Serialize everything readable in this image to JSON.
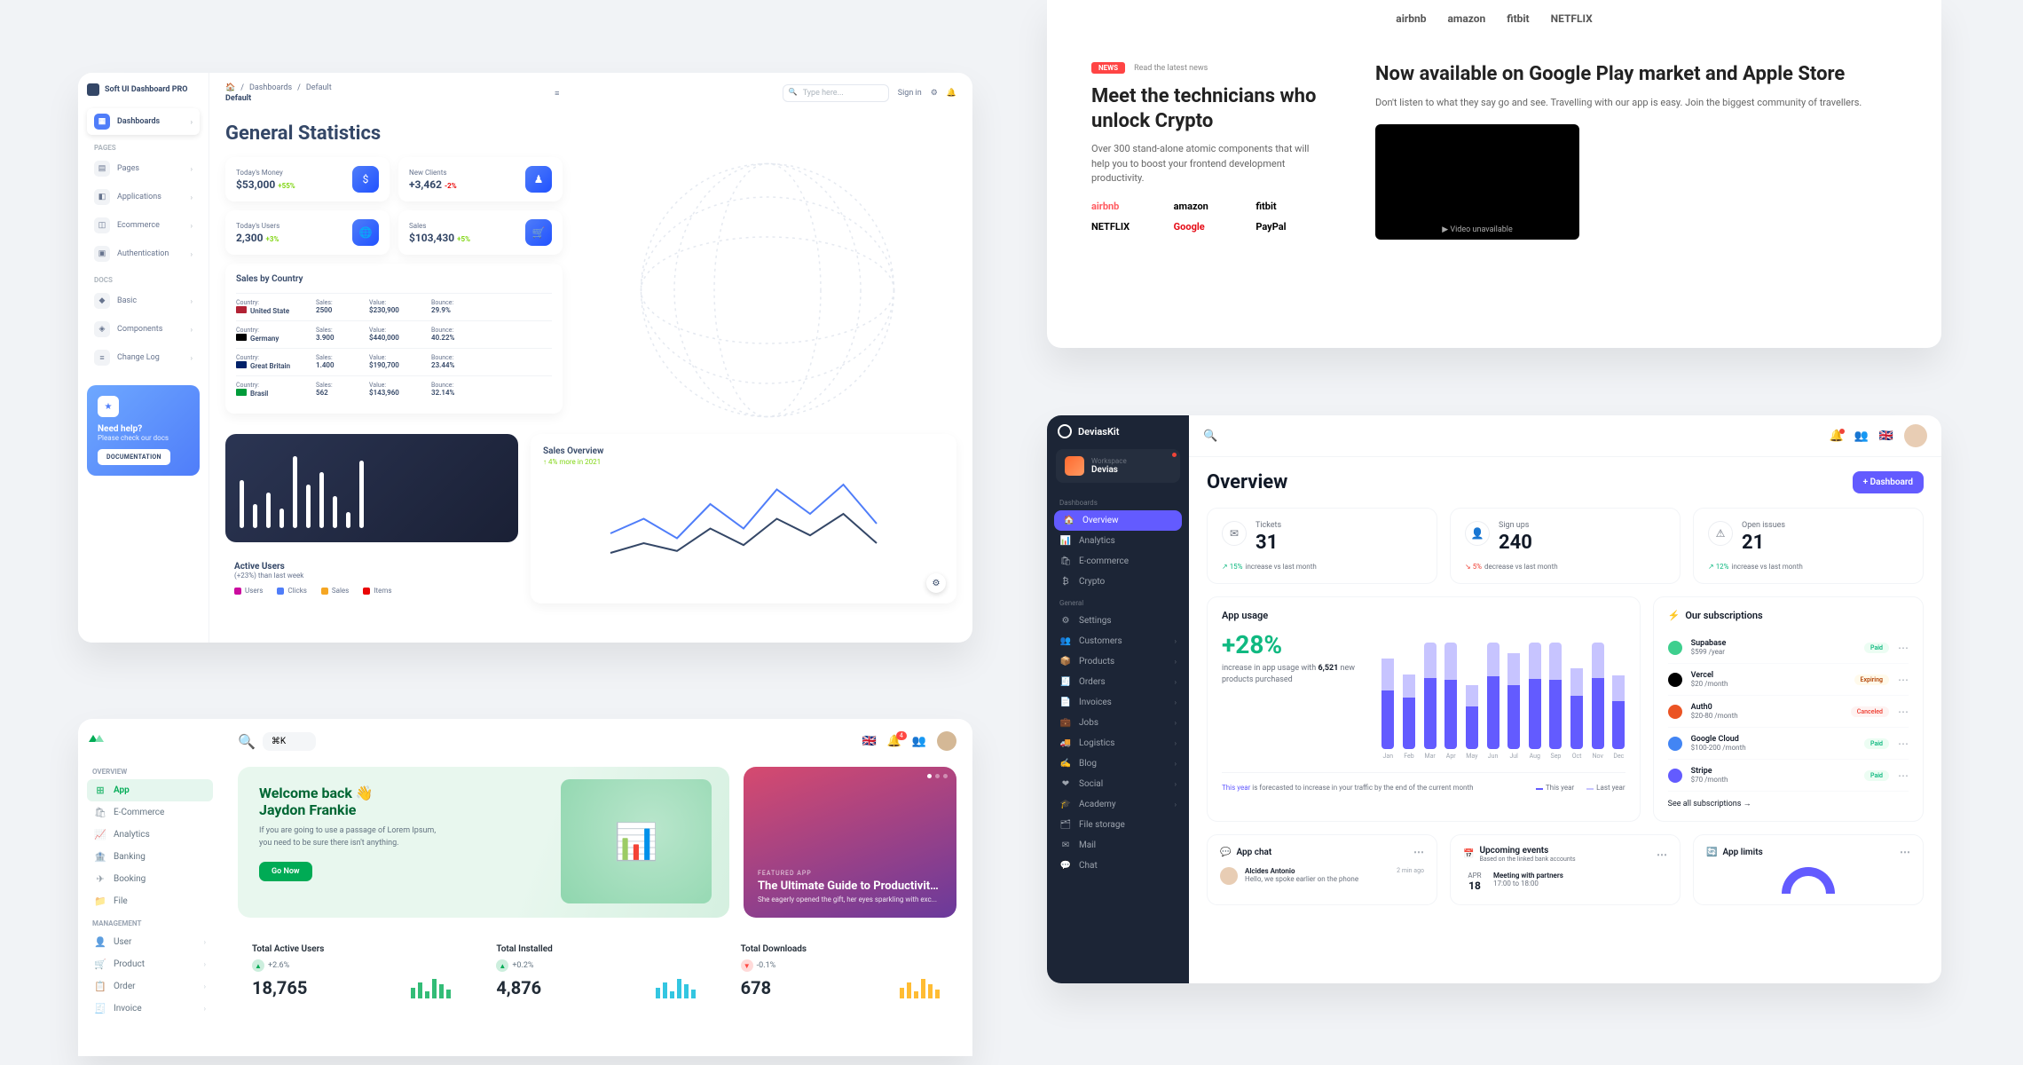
{
  "panel_a": {
    "brand": "Soft UI Dashboard PRO",
    "breadcrumb": {
      "home": "🏠",
      "path": "Dashboards",
      "current": "Default"
    },
    "page_label": "Default",
    "search_placeholder": "Type here...",
    "signin": "Sign in",
    "sidebar": {
      "sections": [
        {
          "items": [
            {
              "label": "Dashboards",
              "icon": "▦",
              "active": true
            }
          ]
        },
        {
          "label": "PAGES",
          "items": [
            {
              "label": "Pages",
              "icon": "▤"
            },
            {
              "label": "Applications",
              "icon": "◧"
            },
            {
              "label": "Ecommerce",
              "icon": "◫"
            },
            {
              "label": "Authentication",
              "icon": "▣"
            }
          ]
        },
        {
          "label": "DOCS",
          "items": [
            {
              "label": "Basic",
              "icon": "◆"
            },
            {
              "label": "Components",
              "icon": "◈"
            },
            {
              "label": "Change Log",
              "icon": "≡"
            }
          ]
        }
      ],
      "help": {
        "title": "Need help?",
        "subtitle": "Please check our docs",
        "button": "DOCUMENTATION",
        "icon": "★"
      }
    },
    "title": "General Statistics",
    "stats": [
      {
        "label": "Today's Money",
        "value": "$53,000",
        "delta": "+55%",
        "dir": "up",
        "icon": "$"
      },
      {
        "label": "New Clients",
        "value": "+3,462",
        "delta": "-2%",
        "dir": "dn",
        "icon": "♟"
      },
      {
        "label": "Today's Users",
        "value": "2,300",
        "delta": "+3%",
        "dir": "up",
        "icon": "🌐"
      },
      {
        "label": "Sales",
        "value": "$103,430",
        "delta": "+5%",
        "dir": "up",
        "icon": "🛒"
      }
    ],
    "sbc": {
      "title": "Sales by Country",
      "cols": [
        "Country:",
        "Sales:",
        "Value:",
        "Bounce:"
      ],
      "rows": [
        {
          "flag": "#b22234",
          "country": "United State",
          "sales": "2500",
          "value": "$230,900",
          "bounce": "29.9%"
        },
        {
          "flag": "#000",
          "country": "Germany",
          "sales": "3.900",
          "value": "$440,000",
          "bounce": "40.22%"
        },
        {
          "flag": "#012169",
          "country": "Great Britain",
          "sales": "1.400",
          "value": "$190,700",
          "bounce": "23.44%"
        },
        {
          "flag": "#009b3a",
          "country": "Brasil",
          "sales": "562",
          "value": "$143,960",
          "bounce": "32.14%"
        }
      ]
    },
    "active_users": {
      "title": "Active Users",
      "subtitle": "(+23%) than last week",
      "legend": [
        {
          "label": "Users",
          "color": "#cb0c9f"
        },
        {
          "label": "Clicks",
          "color": "#4f7df9"
        },
        {
          "label": "Sales",
          "color": "#f5a623"
        },
        {
          "label": "Items",
          "color": "#ea0606"
        }
      ]
    },
    "sales_overview": {
      "title": "Sales Overview",
      "subtitle": "↑ 4% more in 2021"
    }
  },
  "chart_data": [
    {
      "id": "pa_bars",
      "type": "bar",
      "values": [
        60,
        30,
        45,
        25,
        90,
        55,
        70,
        40,
        20,
        85
      ],
      "ylim": [
        0,
        100
      ]
    },
    {
      "id": "pa_line",
      "type": "line",
      "series": [
        {
          "name": "A",
          "color": "#4f7df9",
          "values": [
            40,
            55,
            35,
            70,
            45,
            85,
            60,
            90,
            50
          ]
        },
        {
          "name": "B",
          "color": "#344767",
          "values": [
            20,
            30,
            22,
            45,
            28,
            55,
            38,
            60,
            30
          ]
        }
      ],
      "x": [
        1,
        2,
        3,
        4,
        5,
        6,
        7,
        8,
        9
      ],
      "ylim": [
        0,
        100
      ]
    },
    {
      "id": "pd_bars",
      "type": "bar",
      "categories": [
        "Jan",
        "Feb",
        "Mar",
        "Apr",
        "May",
        "Jun",
        "Jul",
        "Aug",
        "Sep",
        "Oct",
        "Nov",
        "Dec"
      ],
      "series": [
        {
          "name": "This year",
          "color": "#635bff",
          "values": [
            55,
            48,
            90,
            65,
            40,
            85,
            60,
            92,
            70,
            50,
            85,
            45
          ]
        },
        {
          "name": "Last year",
          "color": "#c7c4ff",
          "values": [
            30,
            22,
            45,
            35,
            20,
            40,
            30,
            48,
            38,
            26,
            42,
            24
          ]
        }
      ],
      "ylim": [
        0,
        100
      ]
    }
  ],
  "panel_b": {
    "top_brands": [
      "airbnb",
      "amazon",
      "fitbit",
      "NETFLIX"
    ],
    "news_badge": "NEWS",
    "news_link": "Read the latest news",
    "col1": {
      "title": "Meet the technicians who unlock Crypto",
      "sub": "Over 300 stand-alone atomic components that will help you to boost your frontend development productivity.",
      "brands": [
        "airbnb",
        "amazon",
        "fitbit",
        "NETFLIX",
        "Google",
        "PayPal"
      ]
    },
    "col2": {
      "title": "Now available on Google Play market and Apple Store",
      "sub": "Don't listen to what they say go and see. Travelling with our app is easy. Join the biggest community of travellers.",
      "video": "Video unavailable"
    }
  },
  "panel_c": {
    "search": "⌘K",
    "sections": [
      {
        "label": "OVERVIEW",
        "items": [
          {
            "label": "App",
            "icon": "⊞",
            "active": true
          },
          {
            "label": "E-Commerce",
            "icon": "🛍"
          },
          {
            "label": "Analytics",
            "icon": "📈"
          },
          {
            "label": "Banking",
            "icon": "🏦"
          },
          {
            "label": "Booking",
            "icon": "✈"
          },
          {
            "label": "File",
            "icon": "📁"
          }
        ]
      },
      {
        "label": "MANAGEMENT",
        "items": [
          {
            "label": "User",
            "icon": "👤",
            "chev": true
          },
          {
            "label": "Product",
            "icon": "🛒",
            "chev": true
          },
          {
            "label": "Order",
            "icon": "📋",
            "chev": true
          },
          {
            "label": "Invoice",
            "icon": "🧾",
            "chev": true
          }
        ]
      }
    ],
    "hero": {
      "greeting": "Welcome back 👋",
      "name": "Jaydon Frankie",
      "sub": "If you are going to use a passage of Lorem Ipsum, you need to be sure there isn't anything.",
      "cta": "Go Now"
    },
    "featured": {
      "label": "FEATURED APP",
      "title": "The Ultimate Guide to Productivity H...",
      "sub": "She eagerly opened the gift, her eyes sparkling with exc..."
    },
    "stats": [
      {
        "label": "Total Active Users",
        "delta": "+2.6%",
        "dir": "up",
        "value": "18,765",
        "spark": "#00ab55"
      },
      {
        "label": "Total Installed",
        "delta": "+0.2%",
        "dir": "up",
        "value": "4,876",
        "spark": "#00b8d9"
      },
      {
        "label": "Total Downloads",
        "delta": "-0.1%",
        "dir": "dn",
        "value": "678",
        "spark": "#ffab00"
      }
    ]
  },
  "panel_d": {
    "brand": "DeviasKit",
    "workspace": {
      "label": "Workspace",
      "name": "Devias"
    },
    "nav": [
      {
        "label": "Dashboards",
        "items": [
          {
            "label": "Overview",
            "icon": "🏠",
            "active": true
          },
          {
            "label": "Analytics",
            "icon": "📊"
          },
          {
            "label": "E-commerce",
            "icon": "🛍"
          },
          {
            "label": "Crypto",
            "icon": "₿"
          }
        ]
      },
      {
        "label": "General",
        "items": [
          {
            "label": "Settings",
            "icon": "⚙"
          },
          {
            "label": "Customers",
            "icon": "👥",
            "chev": true
          },
          {
            "label": "Products",
            "icon": "📦",
            "chev": true
          },
          {
            "label": "Orders",
            "icon": "🧾",
            "chev": true
          },
          {
            "label": "Invoices",
            "icon": "📄",
            "chev": true
          },
          {
            "label": "Jobs",
            "icon": "💼",
            "chev": true
          },
          {
            "label": "Logistics",
            "icon": "🚚",
            "chev": true
          },
          {
            "label": "Blog",
            "icon": "✍",
            "chev": true
          },
          {
            "label": "Social",
            "icon": "❤",
            "chev": true
          },
          {
            "label": "Academy",
            "icon": "🎓",
            "chev": true
          },
          {
            "label": "File storage",
            "icon": "🗂"
          },
          {
            "label": "Mail",
            "icon": "✉"
          },
          {
            "label": "Chat",
            "icon": "💬"
          }
        ]
      }
    ],
    "title": "Overview",
    "new_btn": "+ Dashboard",
    "kpis": [
      {
        "label": "Tickets",
        "value": "31",
        "delta": "15%",
        "dir": "up",
        "note": "increase vs last month",
        "icon": "✉"
      },
      {
        "label": "Sign ups",
        "value": "240",
        "delta": "5%",
        "dir": "dn",
        "note": "decrease vs last month",
        "icon": "👤"
      },
      {
        "label": "Open issues",
        "value": "21",
        "delta": "12%",
        "dir": "up",
        "note": "increase vs last month",
        "icon": "⚠"
      }
    ],
    "app_usage": {
      "title": "App usage",
      "big": "+28%",
      "sub_a": "increase in app usage with",
      "sub_b": "6,521",
      "sub_c": " new products purchased",
      "note_a": "This year",
      "note_b": " is forecasted to increase in your traffic by the end of the current month",
      "legend": [
        {
          "label": "This year",
          "color": "#635bff"
        },
        {
          "label": "Last year",
          "color": "#c7c4ff"
        }
      ]
    },
    "subs": {
      "title": "Our subscriptions",
      "items": [
        {
          "name": "Supabase",
          "price": "$599 /year",
          "status": "Paid",
          "color": "#3ecf8e"
        },
        {
          "name": "Vercel",
          "price": "$20 /month",
          "status": "Expiring",
          "color": "#000"
        },
        {
          "name": "Auth0",
          "price": "$20-80 /month",
          "status": "Canceled",
          "color": "#eb5424"
        },
        {
          "name": "Google Cloud",
          "price": "$100-200 /month",
          "status": "Paid",
          "color": "#4285f4"
        },
        {
          "name": "Stripe",
          "price": "$70 /month",
          "status": "Paid",
          "color": "#635bff"
        }
      ],
      "see_all": "See all subscriptions →"
    },
    "chat": {
      "title": "App chat",
      "name": "Alcides Antonio",
      "msg": "Hello, we spoke earlier on the phone",
      "time": "2 min ago"
    },
    "events": {
      "title": "Upcoming events",
      "sub": "Based on the linked bank accounts",
      "item": {
        "month": "APR",
        "day": "18",
        "title": "Meeting with partners",
        "time": "17:00 to 18:00"
      }
    },
    "limits": {
      "title": "App limits"
    }
  }
}
